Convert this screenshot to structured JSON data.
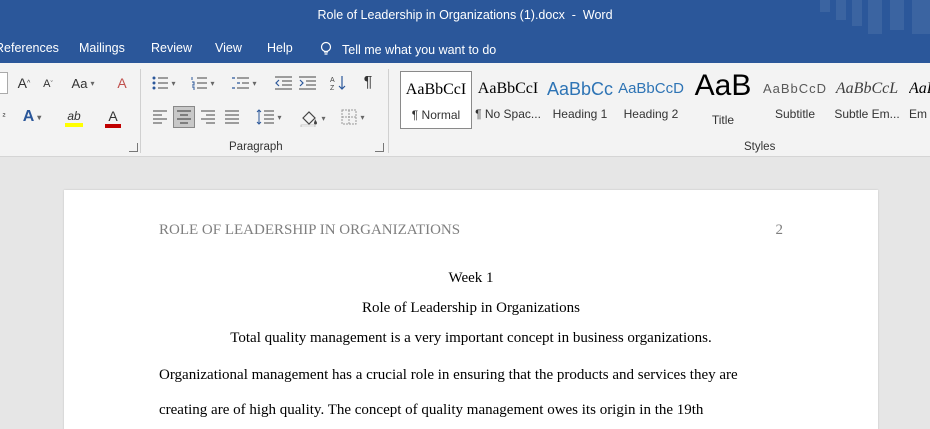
{
  "titlebar": {
    "document_name": "Role of Leadership in Organizations (1).docx",
    "separator": "  -  ",
    "app_name": "Word"
  },
  "menu": {
    "tabs": [
      "References",
      "Mailings",
      "Review",
      "View",
      "Help"
    ],
    "tell_me": "Tell me what you want to do"
  },
  "ribbon": {
    "font": {
      "grow_glyph": "A",
      "shrink_glyph": "A",
      "case_glyph": "Aa",
      "clear_glyph": "A",
      "effects_glyph": "A",
      "highlight_glyph": "ab",
      "color_glyph": "A",
      "highlight_color": "#ffff00",
      "font_color": "#c00000"
    },
    "paragraph": {
      "label": "Paragraph",
      "pilcrow": "¶"
    },
    "styles": {
      "label": "Styles",
      "items": [
        {
          "sample": "AaBbCcI",
          "name": "¶ Normal"
        },
        {
          "sample": "AaBbCcI",
          "name": "¶ No Spac..."
        },
        {
          "sample": "AaBbCc",
          "name": "Heading 1"
        },
        {
          "sample": "AaBbCcD",
          "name": "Heading 2"
        },
        {
          "sample": "AaB",
          "name": "Title"
        },
        {
          "sample": "AaBbCcD",
          "name": "Subtitle"
        },
        {
          "sample": "AaBbCcL",
          "name": "Subtle Em..."
        },
        {
          "sample": "AaBl",
          "name": "Em"
        }
      ],
      "selected_index": 0,
      "heading_color": "#2e74b5"
    }
  },
  "document": {
    "header_title": "ROLE OF LEADERSHIP IN ORGANIZATIONS",
    "page_number": "2",
    "week": "Week 1",
    "title": "Role of Leadership in Organizations",
    "intro": "Total quality management is a very important concept in business organizations.",
    "line1": "Organizational management has a crucial role in ensuring that the products and services they are",
    "line2": "creating are of high quality. The concept of quality management owes its origin in the 19th"
  }
}
